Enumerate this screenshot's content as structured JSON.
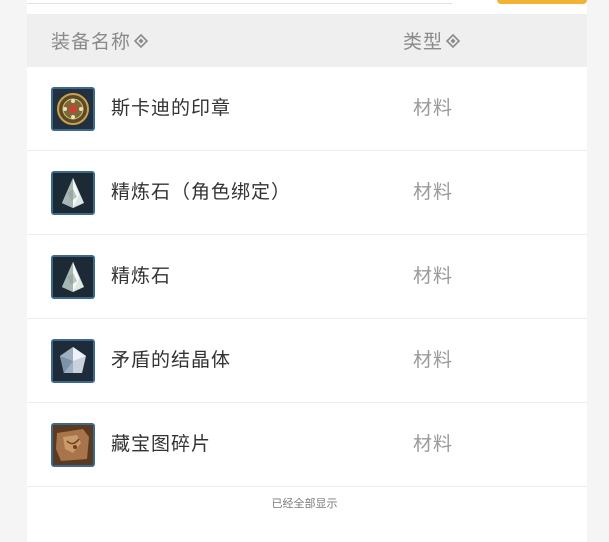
{
  "table": {
    "headers": {
      "name": "装备名称",
      "type": "类型",
      "sort_icon": "sort-diamond-icon"
    },
    "rows": [
      {
        "name": "斯卡迪的印章",
        "type": "材料",
        "icon": "skadi-seal-icon"
      },
      {
        "name": "精炼石（角色绑定）",
        "type": "材料",
        "icon": "refining-stone-icon"
      },
      {
        "name": "精炼石",
        "type": "材料",
        "icon": "refining-stone-icon"
      },
      {
        "name": "矛盾的结晶体",
        "type": "材料",
        "icon": "contradiction-crystal-icon"
      },
      {
        "name": "藏宝图碎片",
        "type": "材料",
        "icon": "treasure-map-fragment-icon"
      }
    ]
  },
  "footer": {
    "text": "已经全部显示"
  },
  "colors": {
    "accent": "#f2b233",
    "header_bg": "#efefef",
    "icon_border": "#3d6a8a"
  }
}
